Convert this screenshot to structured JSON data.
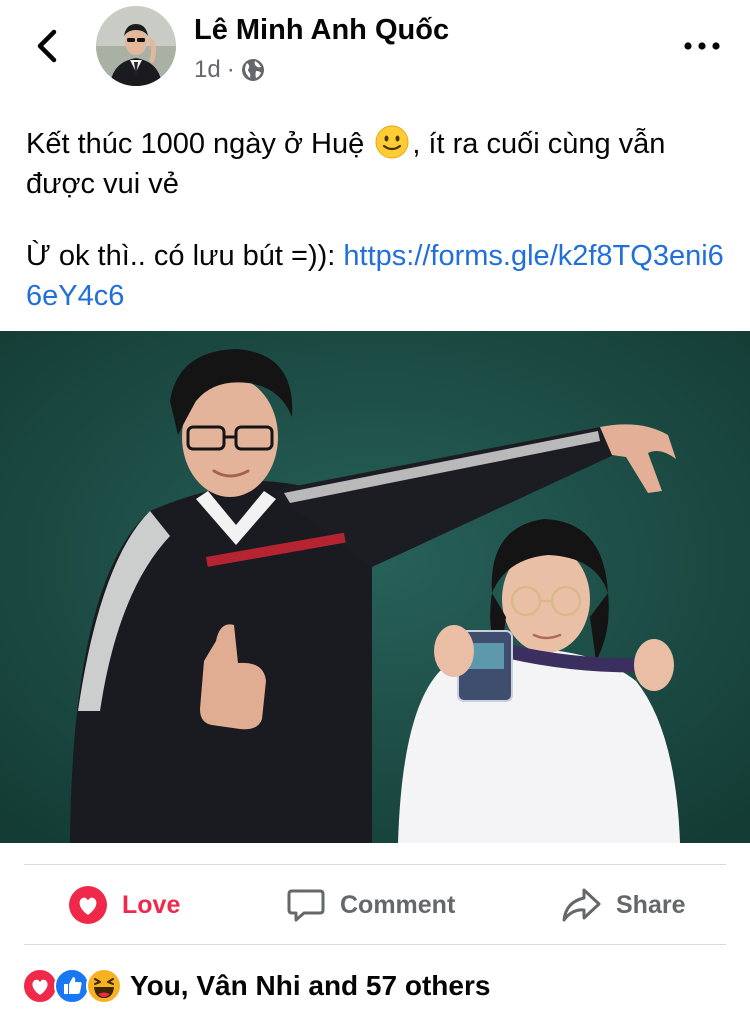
{
  "header": {
    "author": "Lê Minh Anh Quốc",
    "time": "1d",
    "separator": "·",
    "audience_icon": "globe-icon"
  },
  "post": {
    "line1_before_emoji": "Kết thúc 1000 ngày ở Huệ ",
    "line1_after_emoji": ", ít ra cuối cùng vẫn được vui vẻ",
    "line2_text": "Ừ ok thì.. có lưu bút =)): ",
    "link": "https://forms.gle/k2f8TQ3eni66eY4c6"
  },
  "actions": {
    "love_label": "Love",
    "comment_label": "Comment",
    "share_label": "Share"
  },
  "reactions": {
    "icons": [
      "love-icon",
      "like-icon",
      "haha-icon"
    ],
    "summary": "You, Vân Nhi and 57 others"
  },
  "colors": {
    "love": "#f0284a",
    "link": "#216fdb",
    "muted": "#65676b",
    "like": "#1877f2",
    "haha": "#f7b125",
    "photo_background": "#1d4c44"
  }
}
